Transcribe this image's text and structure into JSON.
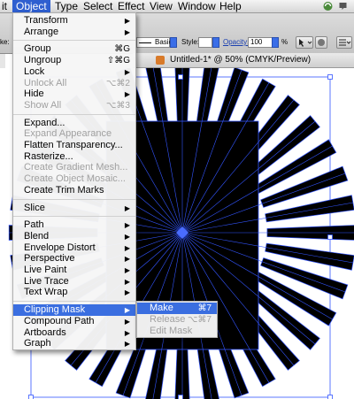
{
  "menubar": {
    "items": [
      "it",
      "Object",
      "Type",
      "Select",
      "Effect",
      "View",
      "Window",
      "Help"
    ],
    "active_index": 1
  },
  "control_bar": {
    "stroke_label": "ke:",
    "style_label": "Basic",
    "style_field_label": "Style:",
    "opacity_label": "Opacity:",
    "opacity_value": "100",
    "opacity_unit": "%"
  },
  "document_tab": {
    "title": "Untitled-1* @ 50% (CMYK/Preview)"
  },
  "object_menu": {
    "items": [
      {
        "label": "Transform",
        "shortcut": "",
        "submenu": true,
        "disabled": false
      },
      {
        "label": "Arrange",
        "shortcut": "",
        "submenu": true,
        "disabled": false
      },
      {
        "label": "Group",
        "shortcut": "⌘G",
        "submenu": false,
        "disabled": false
      },
      {
        "label": "Ungroup",
        "shortcut": "⇧⌘G",
        "submenu": false,
        "disabled": false
      },
      {
        "label": "Lock",
        "shortcut": "",
        "submenu": true,
        "disabled": false
      },
      {
        "label": "Unlock All",
        "shortcut": "⌥⌘2",
        "submenu": false,
        "disabled": true
      },
      {
        "label": "Hide",
        "shortcut": "",
        "submenu": true,
        "disabled": false
      },
      {
        "label": "Show All",
        "shortcut": "⌥⌘3",
        "submenu": false,
        "disabled": true
      },
      {
        "label": "Expand...",
        "shortcut": "",
        "submenu": false,
        "disabled": false
      },
      {
        "label": "Expand Appearance",
        "shortcut": "",
        "submenu": false,
        "disabled": true
      },
      {
        "label": "Flatten Transparency...",
        "shortcut": "",
        "submenu": false,
        "disabled": false
      },
      {
        "label": "Rasterize...",
        "shortcut": "",
        "submenu": false,
        "disabled": false
      },
      {
        "label": "Create Gradient Mesh...",
        "shortcut": "",
        "submenu": false,
        "disabled": true
      },
      {
        "label": "Create Object Mosaic...",
        "shortcut": "",
        "submenu": false,
        "disabled": true
      },
      {
        "label": "Create Trim Marks",
        "shortcut": "",
        "submenu": false,
        "disabled": false
      },
      {
        "label": "Slice",
        "shortcut": "",
        "submenu": true,
        "disabled": false
      },
      {
        "label": "Path",
        "shortcut": "",
        "submenu": true,
        "disabled": false
      },
      {
        "label": "Blend",
        "shortcut": "",
        "submenu": true,
        "disabled": false
      },
      {
        "label": "Envelope Distort",
        "shortcut": "",
        "submenu": true,
        "disabled": false
      },
      {
        "label": "Perspective",
        "shortcut": "",
        "submenu": true,
        "disabled": false
      },
      {
        "label": "Live Paint",
        "shortcut": "",
        "submenu": true,
        "disabled": false
      },
      {
        "label": "Live Trace",
        "shortcut": "",
        "submenu": true,
        "disabled": false
      },
      {
        "label": "Text Wrap",
        "shortcut": "",
        "submenu": true,
        "disabled": false
      },
      {
        "label": "Clipping Mask",
        "shortcut": "",
        "submenu": true,
        "disabled": false
      },
      {
        "label": "Compound Path",
        "shortcut": "",
        "submenu": true,
        "disabled": false
      },
      {
        "label": "Artboards",
        "shortcut": "",
        "submenu": true,
        "disabled": false
      },
      {
        "label": "Graph",
        "shortcut": "",
        "submenu": true,
        "disabled": false
      }
    ],
    "highlighted_index": 23
  },
  "clipping_submenu": {
    "items": [
      {
        "label": "Make",
        "shortcut": "⌘7",
        "disabled": false
      },
      {
        "label": "Release",
        "shortcut": "⌥⌘7",
        "disabled": true
      },
      {
        "label": "Edit Mask",
        "shortcut": "",
        "disabled": true
      }
    ],
    "highlighted_index": 0
  },
  "colors": {
    "menu_highlight": "#3a6ee0",
    "selection_blue": "#3355ff",
    "artwork_fill": "#000000"
  }
}
